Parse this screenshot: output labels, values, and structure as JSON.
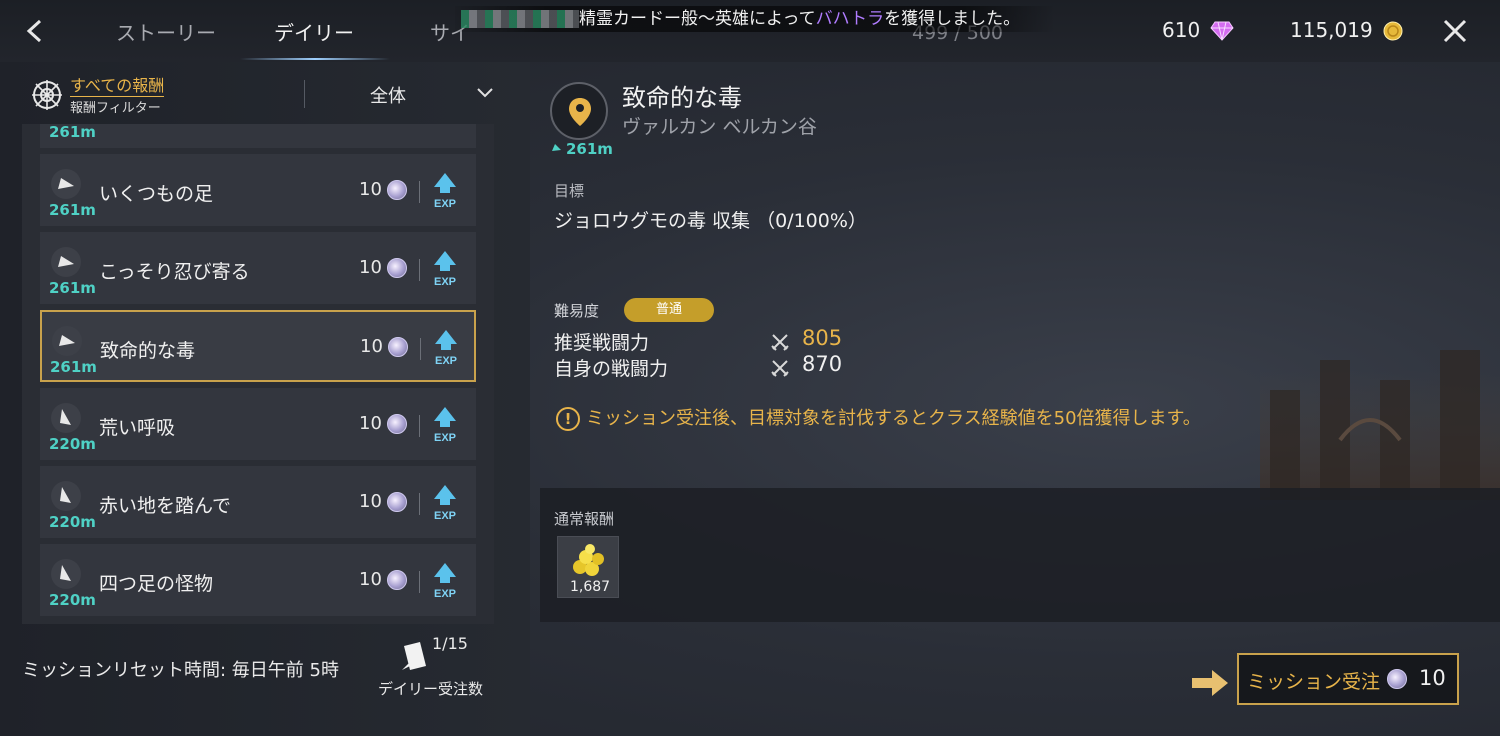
{
  "header": {
    "tabs": [
      {
        "label": "ストーリー"
      },
      {
        "label": "デイリー"
      },
      {
        "label": "サイ"
      }
    ],
    "notification": {
      "prefix": "精霊カードー般〜英雄によって",
      "highlight": "バハトラ",
      "suffix": "を獲得しました。"
    },
    "subcount": "499 / 500",
    "gems": "610",
    "gold": "115,019"
  },
  "filter": {
    "title": "すべての報酬",
    "subtitle": "報酬フィルター",
    "value": "全体"
  },
  "missions": [
    {
      "distance": "261m",
      "name": "",
      "cost": ""
    },
    {
      "distance": "261m",
      "name": "いくつもの足",
      "cost": "10"
    },
    {
      "distance": "261m",
      "name": "こっそり忍び寄る",
      "cost": "10"
    },
    {
      "distance": "261m",
      "name": "致命的な毒",
      "cost": "10"
    },
    {
      "distance": "220m",
      "name": "荒い呼吸",
      "cost": "10"
    },
    {
      "distance": "220m",
      "name": "赤い地を踏んで",
      "cost": "10"
    },
    {
      "distance": "220m",
      "name": "四つ足の怪物",
      "cost": "10"
    }
  ],
  "footer": {
    "reset": "ミッションリセット時間: 毎日午前 5時",
    "daily_count": "1/15",
    "daily_label": "デイリー受注数"
  },
  "detail": {
    "title": "致命的な毒",
    "location": "ヴァルカン ベルカン谷",
    "distance": "261m",
    "objective_label": "目標",
    "objective": "ジョロウグモの毒 収集 （0/100%）",
    "difficulty_label": "難易度",
    "difficulty": "普通",
    "rec_power_label": "推奨戦闘力",
    "rec_power": "805",
    "own_power_label": "自身の戦闘力",
    "own_power": "870",
    "notice": "ミッション受注後、目標対象を討伐するとクラス経験値を50倍獲得します。",
    "reward_label": "通常報酬",
    "reward_qty": "1,687",
    "accept_label": "ミッション受注",
    "accept_cost": "10"
  },
  "colors": {
    "gold": "#e8b44a",
    "teal": "#4fd1c5",
    "selected_border": "#c9a24c"
  }
}
